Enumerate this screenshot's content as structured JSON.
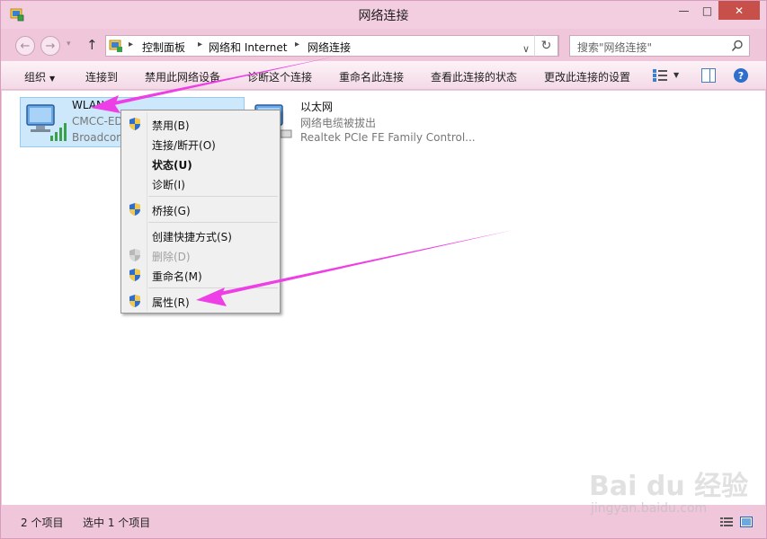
{
  "window": {
    "title": "网络连接",
    "controls": {
      "minimize": "—",
      "maximize": "□",
      "close": "✕"
    }
  },
  "nav": {
    "back": "←",
    "forward": "→",
    "recent": "▾",
    "up": "↑",
    "breadcrumb": [
      "控制面板",
      "网络和 Internet",
      "网络连接"
    ],
    "breadcrumb_sep": "▸",
    "dropdown": "∨",
    "refresh": "↻",
    "search_placeholder": "搜索\"网络连接\""
  },
  "commands": {
    "organize": "组织",
    "organize_caret": "▼",
    "connect": "连接到",
    "disable": "禁用此网络设备",
    "diagnose": "诊断这个连接",
    "rename": "重命名此连接",
    "view_status": "查看此连接的状态",
    "change_settings": "更改此连接的设置",
    "view_caret": "▼",
    "help": "?"
  },
  "items": [
    {
      "name": "WLAN",
      "line1": "CMCC-ED",
      "line2": "Broadcor"
    },
    {
      "name": "以太网",
      "line1": "网络电缆被拔出",
      "line2": "Realtek PCIe FE Family Control..."
    }
  ],
  "context_menu": {
    "disable": "禁用(B)",
    "connect": "连接/断开(O)",
    "status": "状态(U)",
    "diagnose": "诊断(I)",
    "bridge": "桥接(G)",
    "shortcut": "创建快捷方式(S)",
    "delete": "删除(D)",
    "rename": "重命名(M)",
    "properties": "属性(R)"
  },
  "status": {
    "count": "2 个项目",
    "selected": "选中 1 个项目"
  },
  "watermark": {
    "brand": "Bai du 经验",
    "url": "jingyan.baidu.com"
  },
  "colors": {
    "arrow": "#ee3fe6",
    "selection": "#cde8fb",
    "close": "#c7504a",
    "frame": "#f0c6db"
  }
}
